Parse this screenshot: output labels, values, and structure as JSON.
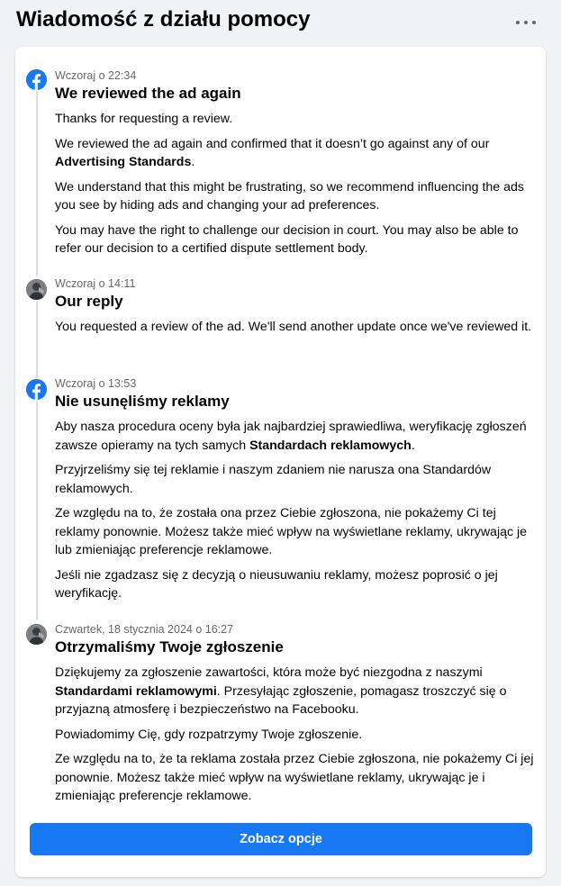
{
  "header": {
    "title": "Wiadomość z działu pomocy"
  },
  "messages": [
    {
      "time": "Wczoraj o 22:34",
      "title": "We reviewed the ad again",
      "p1": "Thanks for requesting a review.",
      "p2_a": "We reviewed the ad again and confirmed that it doesn’t go against any of our ",
      "p2_b": "Advertising Standards",
      "p2_c": ".",
      "p3": "We understand that this might be frustrating, so we recommend influencing the ads you see by hiding ads and changing your ad preferences.",
      "p4": "You may have the right to challenge our decision in court. You may also be able to refer our decision to a certified dispute settlement body."
    },
    {
      "time": "Wczoraj o 14:11",
      "title": "Our reply",
      "p1": "You requested a review of the ad. We'll send another update once we've reviewed it."
    },
    {
      "time": "Wczoraj o 13:53",
      "title": "Nie usunęliśmy reklamy",
      "p1_a": "Aby nasza procedura oceny była jak najbardziej sprawiedliwa, weryfikację zgłoszeń zawsze opieramy na tych samych ",
      "p1_b": "Standardach reklamowych",
      "p1_c": ".",
      "p2": "Przyjrzeliśmy się tej reklamie i naszym zdaniem nie narusza ona Standardów reklamowych.",
      "p3": "Ze względu na to, że została ona przez Ciebie zgłoszona, nie pokażemy Ci tej reklamy ponownie. Możesz także mieć wpływ na wyświetlane reklamy, ukrywając je lub zmieniając preferencje reklamowe.",
      "p4": "Jeśli nie zgadzasz się z decyzją o nieusuwaniu reklamy, możesz poprosić o jej weryfikację."
    },
    {
      "time": "Czwartek, 18 stycznia 2024 o 16:27",
      "title": "Otrzymaliśmy Twoje zgłoszenie",
      "p1_a": "Dziękujemy za zgłoszenie zawartości, która może być niezgodna z naszymi ",
      "p1_b": "Standardami reklamowymi",
      "p1_c": ". Przesyłając zgłoszenie, pomagasz troszczyć się o przyjazną atmosferę i bezpieczeństwo na Facebooku.",
      "p2": "Powiadomimy Cię, gdy rozpatrzymy Twoje zgłoszenie.",
      "p3": "Ze względu na to, że ta reklama została przez Ciebie zgłoszona, nie pokażemy Ci jej ponownie. Możesz także mieć wpływ na wyświetlane reklamy, ukrywając je i zmieniając preferencje reklamowe."
    }
  ],
  "actions": {
    "see_options": "Zobacz opcje"
  },
  "icons": {
    "more": "more-horizontal-icon",
    "facebook": "facebook-logo-icon",
    "user": "user-avatar"
  },
  "colors": {
    "accent": "#1877f2",
    "background": "#f0f2f5",
    "secondary_text": "#65676b"
  }
}
